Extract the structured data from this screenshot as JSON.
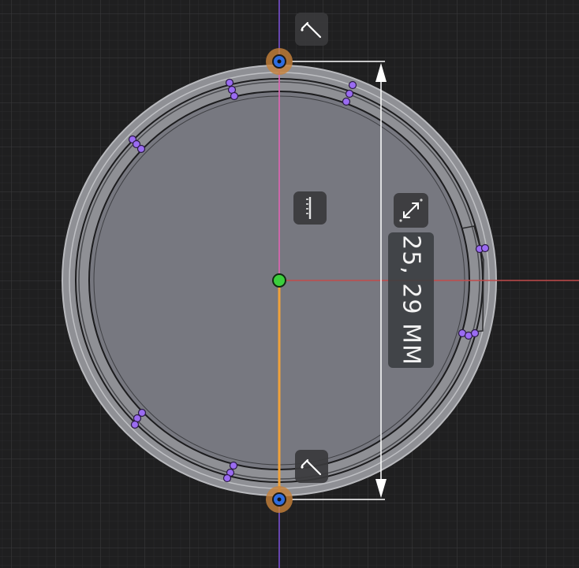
{
  "viewport": {
    "background": "#1f1f20",
    "grid_minor_color": "#2c2c2e",
    "grid_major_color": "#3a3a3d"
  },
  "axes": {
    "x_axis_color": "#c24b4b",
    "y_axis_color": "#7b4fd8"
  },
  "sketch": {
    "selected_diameter_color": "#f0a23b",
    "origin_point_color": "#3ccf3c",
    "endpoint_color": "#2f6de0",
    "constraint_marker_color": "#9b6cf2"
  },
  "dimension": {
    "value_text": "25, 29 MM"
  },
  "toolbar_icons": {
    "top": "diagonal-constraint-icon",
    "bottom": "diagonal-constraint-icon",
    "vertical": "vertical-constraint-icon",
    "diameter": "diameter-arrows-icon"
  }
}
